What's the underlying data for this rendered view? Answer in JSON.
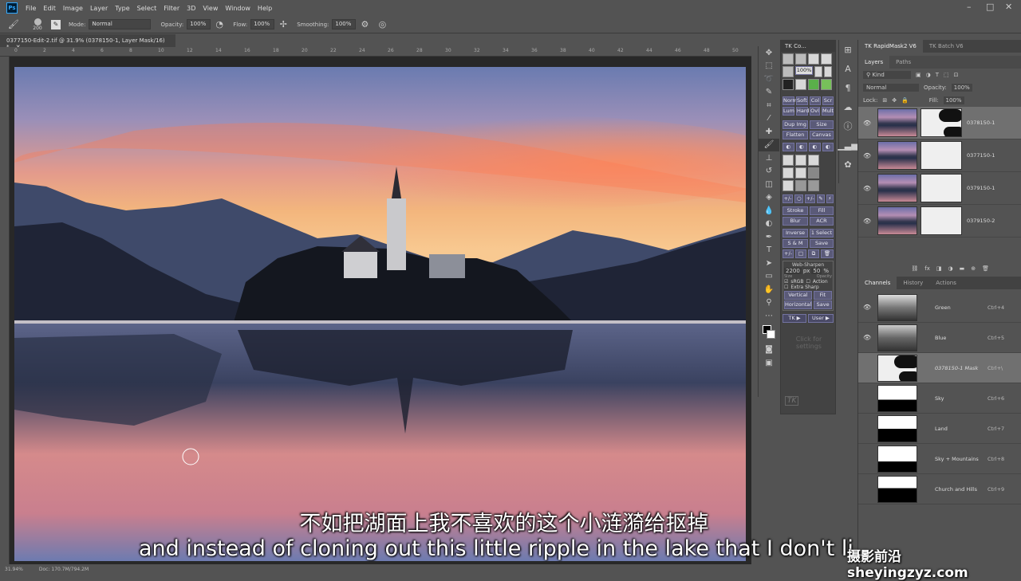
{
  "app": {
    "logo": "Ps"
  },
  "menubar": {
    "items": [
      "File",
      "Edit",
      "Image",
      "Layer",
      "Type",
      "Select",
      "Filter",
      "3D",
      "View",
      "Window",
      "Help"
    ]
  },
  "options": {
    "brush_size": "200",
    "mode_label": "Mode:",
    "mode_value": "Normal",
    "opacity_label": "Opacity:",
    "opacity_value": "100%",
    "flow_label": "Flow:",
    "flow_value": "100%",
    "smoothing_label": "Smoothing:",
    "smoothing_value": "100%"
  },
  "document": {
    "tab_title": "0377150-Edit-2.tif @ 31.9% (0378150-1, Layer Mask/16) *",
    "zoom": "31.94%",
    "doc_size": "Doc: 170.7M/794.2M",
    "ruler_ticks": [
      "0",
      "2",
      "4",
      "6",
      "8",
      "10",
      "12",
      "14",
      "16",
      "18",
      "20",
      "22",
      "24",
      "26",
      "28",
      "30",
      "32",
      "34",
      "36",
      "38",
      "40",
      "42",
      "44",
      "46",
      "48",
      "50"
    ]
  },
  "tk_panel": {
    "title": "TK Co...",
    "zoom_value": "100%",
    "blend_row1": [
      "Norm",
      "Soft",
      "Col",
      "Scr"
    ],
    "blend_row2": [
      "Lum",
      "Hard",
      "Ovl",
      "Mult"
    ],
    "row_dup": [
      "Dup Img",
      "Size"
    ],
    "row_flatten": [
      "Flatten",
      "Canvas"
    ],
    "row_stroke": [
      "Stroke",
      "Fill"
    ],
    "row_blur": [
      "Blur",
      "ACR"
    ],
    "row_inverse": [
      "Inverse",
      "1 Select"
    ],
    "row_sm": [
      "S & M",
      "Save"
    ],
    "websharpen_title": "Web-Sharpen",
    "size_value": "2200",
    "size_unit": "px",
    "opacity_value": "50",
    "opacity_unit": "%",
    "size_label": "Size",
    "opacity_label": "Opacity",
    "srgb_label": "sRGB",
    "action_label": "Action",
    "extra_sharp_label": "Extra Sharp",
    "vertical_label": "Vertical",
    "fit_label": "Fit",
    "horizontal_label": "Horizontal",
    "save_label": "Save",
    "tk_btn": "TK ▶",
    "user_btn": "User ▶",
    "placeholder_text": "Click for settings",
    "logo": "TK"
  },
  "layers_panel": {
    "header_tabs": [
      "TK RapidMask2 V6",
      "TK Batch V6"
    ],
    "tabs": [
      "Layers",
      "Paths"
    ],
    "kind_label": "Kind",
    "blend_mode": "Normal",
    "opacity_label": "Opacity:",
    "opacity_value": "100%",
    "lock_label": "Lock:",
    "fill_label": "Fill:",
    "fill_value": "100%",
    "layers": [
      {
        "name": "0378150-1",
        "selected": true
      },
      {
        "name": "0377150-1",
        "selected": false
      },
      {
        "name": "0379150-1",
        "selected": false
      },
      {
        "name": "0379150-2",
        "selected": false
      }
    ]
  },
  "channels_panel": {
    "tabs": [
      "Channels",
      "History",
      "Actions"
    ],
    "channels": [
      {
        "name": "Green",
        "shortcut": "Ctrl+4",
        "visible": true
      },
      {
        "name": "Blue",
        "shortcut": "Ctrl+5",
        "visible": true
      },
      {
        "name": "0378150-1 Mask",
        "shortcut": "Ctrl+\\",
        "visible": false
      },
      {
        "name": "Sky",
        "shortcut": "Ctrl+6",
        "visible": false
      },
      {
        "name": "Land",
        "shortcut": "Ctrl+7",
        "visible": false
      },
      {
        "name": "Sky + Mountains",
        "shortcut": "Ctrl+8",
        "visible": false
      },
      {
        "name": "Church and Hills",
        "shortcut": "Ctrl+9",
        "visible": false
      }
    ]
  },
  "subtitles": {
    "chinese": "不如把湖面上我不喜欢的这个小涟漪给抠掉",
    "english": "and instead of cloning out this little ripple in the lake that I don't li",
    "watermark": "摄影前沿 sheyingzyz.com"
  },
  "colors": {
    "panel_bg": "#535353",
    "tk_button": "#5a5a78",
    "subtitle": "#ffffff"
  }
}
